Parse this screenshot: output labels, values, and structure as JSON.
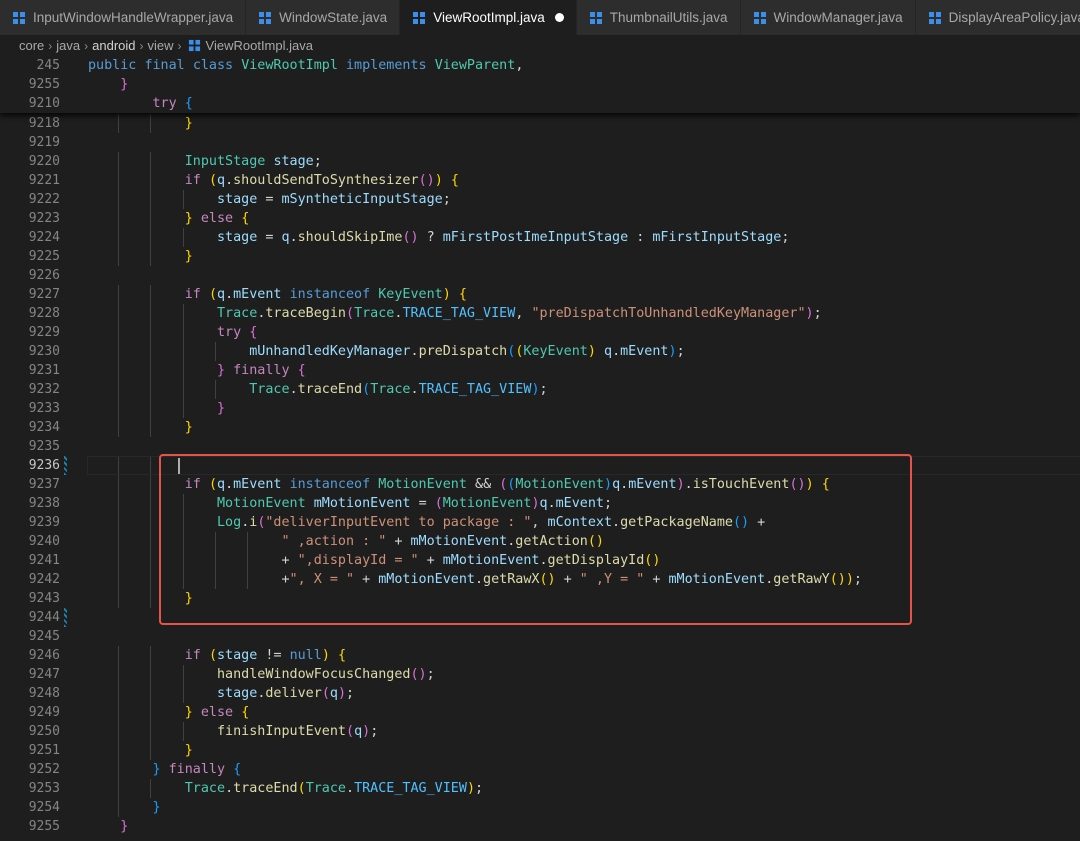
{
  "tabs": [
    {
      "label": "InputWindowHandleWrapper.java",
      "active": false,
      "dirty": false
    },
    {
      "label": "WindowState.java",
      "active": false,
      "dirty": false
    },
    {
      "label": "ViewRootImpl.java",
      "active": true,
      "dirty": true
    },
    {
      "label": "ThumbnailUtils.java",
      "active": false,
      "dirty": false
    },
    {
      "label": "WindowManager.java",
      "active": false,
      "dirty": false
    },
    {
      "label": "DisplayAreaPolicy.java",
      "active": false,
      "dirty": false
    }
  ],
  "breadcrumb": [
    "core",
    "java",
    "android",
    "view",
    "ViewRootImpl.java"
  ],
  "colors": {
    "accent_box": "#e5534b",
    "java_icon": "#3b8eea"
  },
  "sticky_lines": [
    {
      "num": "245",
      "text": "public final class ViewRootImpl implements ViewParent,"
    },
    {
      "num": "9255",
      "text": "    }"
    },
    {
      "num": "9210",
      "text": "        try {"
    }
  ],
  "lines": [
    {
      "num": "9218",
      "text": "            }"
    },
    {
      "num": "9219",
      "text": ""
    },
    {
      "num": "9220",
      "text": "            InputStage stage;"
    },
    {
      "num": "9221",
      "text": "            if (q.shouldSendToSynthesizer()) {"
    },
    {
      "num": "9222",
      "text": "                stage = mSyntheticInputStage;"
    },
    {
      "num": "9223",
      "text": "            } else {"
    },
    {
      "num": "9224",
      "text": "                stage = q.shouldSkipIme() ? mFirstPostImeInputStage : mFirstInputStage;"
    },
    {
      "num": "9225",
      "text": "            }"
    },
    {
      "num": "9226",
      "text": ""
    },
    {
      "num": "9227",
      "text": "            if (q.mEvent instanceof KeyEvent) {"
    },
    {
      "num": "9228",
      "text": "                Trace.traceBegin(Trace.TRACE_TAG_VIEW, \"preDispatchToUnhandledKeyManager\");"
    },
    {
      "num": "9229",
      "text": "                try {"
    },
    {
      "num": "9230",
      "text": "                    mUnhandledKeyManager.preDispatch((KeyEvent) q.mEvent);"
    },
    {
      "num": "9231",
      "text": "                } finally {"
    },
    {
      "num": "9232",
      "text": "                    Trace.traceEnd(Trace.TRACE_TAG_VIEW);"
    },
    {
      "num": "9233",
      "text": "                }"
    },
    {
      "num": "9234",
      "text": "            }"
    },
    {
      "num": "9235",
      "text": ""
    },
    {
      "num": "9236",
      "text": "            "
    },
    {
      "num": "9237",
      "text": "            if (q.mEvent instanceof MotionEvent && ((MotionEvent)q.mEvent).isTouchEvent()) {"
    },
    {
      "num": "9238",
      "text": "                MotionEvent mMotionEvent = (MotionEvent)q.mEvent;"
    },
    {
      "num": "9239",
      "text": "                Log.i(\"deliverInputEvent to package : \", mContext.getPackageName() +"
    },
    {
      "num": "9240",
      "text": "                        \" ,action : \" + mMotionEvent.getAction()"
    },
    {
      "num": "9241",
      "text": "                        + \",displayId = \" + mMotionEvent.getDisplayId()"
    },
    {
      "num": "9242",
      "text": "                        +\", X = \" + mMotionEvent.getRawX() + \" ,Y = \" + mMotionEvent.getRawY());"
    },
    {
      "num": "9243",
      "text": "            }"
    },
    {
      "num": "9244",
      "text": ""
    },
    {
      "num": "9245",
      "text": ""
    },
    {
      "num": "9246",
      "text": "            if (stage != null) {"
    },
    {
      "num": "9247",
      "text": "                handleWindowFocusChanged();"
    },
    {
      "num": "9248",
      "text": "                stage.deliver(q);"
    },
    {
      "num": "9249",
      "text": "            } else {"
    },
    {
      "num": "9250",
      "text": "                finishInputEvent(q);"
    },
    {
      "num": "9251",
      "text": "            }"
    },
    {
      "num": "9252",
      "text": "        } finally {"
    },
    {
      "num": "9253",
      "text": "            Trace.traceEnd(Trace.TRACE_TAG_VIEW);"
    },
    {
      "num": "9254",
      "text": "        }"
    },
    {
      "num": "9255",
      "text": "    }"
    }
  ],
  "current_line": "9236",
  "modified_lines": [
    "9236",
    "9244"
  ]
}
